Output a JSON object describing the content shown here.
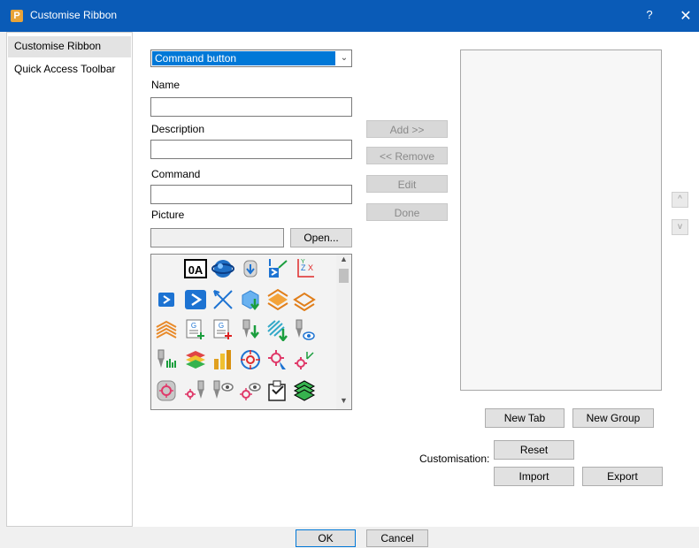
{
  "window": {
    "title": "Customise Ribbon",
    "help": "?",
    "close": "✕"
  },
  "nav": [
    {
      "label": "Customise Ribbon"
    },
    {
      "label": "Quick Access Toolbar"
    }
  ],
  "form": {
    "type_value": "Command button",
    "name_label": "Name",
    "name_value": "",
    "description_label": "Description",
    "description_value": "",
    "command_label": "Command",
    "command_value": "",
    "picture_label": "Picture",
    "picture_value": "",
    "open_button": "Open..."
  },
  "picture_grid": {
    "icons": [
      "blank-icon",
      "zero-a-icon",
      "globe-icon",
      "cylinder-down-icon",
      "arrow-axis-icon",
      "zyx-axis-icon",
      "play-small-icon",
      "play-icon",
      "cross-arrows-icon",
      "cube-down-icon",
      "layers-orange-icon",
      "layers-outline-icon",
      "stripes-orange-icon",
      "gcode-add-icon",
      "gcode-add2-icon",
      "tool-down-icon",
      "stripes-green-down-icon",
      "tool-eye-icon",
      "tool-green-icon",
      "layers-stack-icon",
      "bars-yellow-icon",
      "circle-refresh-icon",
      "target-cursor-icon",
      "target-axis-icon",
      "cylinder-target-icon",
      "target-tool-icon",
      "tool-eye2-icon",
      "target-eye-icon",
      "clipboard-icon",
      "layers-green-icon"
    ]
  },
  "middle_buttons": {
    "add": "Add >>",
    "remove": "<< Remove",
    "edit": "Edit",
    "done": "Done"
  },
  "ribbon_buttons": {
    "up": "^",
    "down": "v",
    "new_tab": "New Tab",
    "new_group": "New Group"
  },
  "customisation": {
    "label": "Customisation:",
    "reset": "Reset",
    "import": "Import",
    "export": "Export"
  },
  "footer": {
    "ok": "OK",
    "cancel": "Cancel"
  },
  "colors": {
    "titlebar": "#0a5bb7",
    "selection": "#0078d7"
  }
}
